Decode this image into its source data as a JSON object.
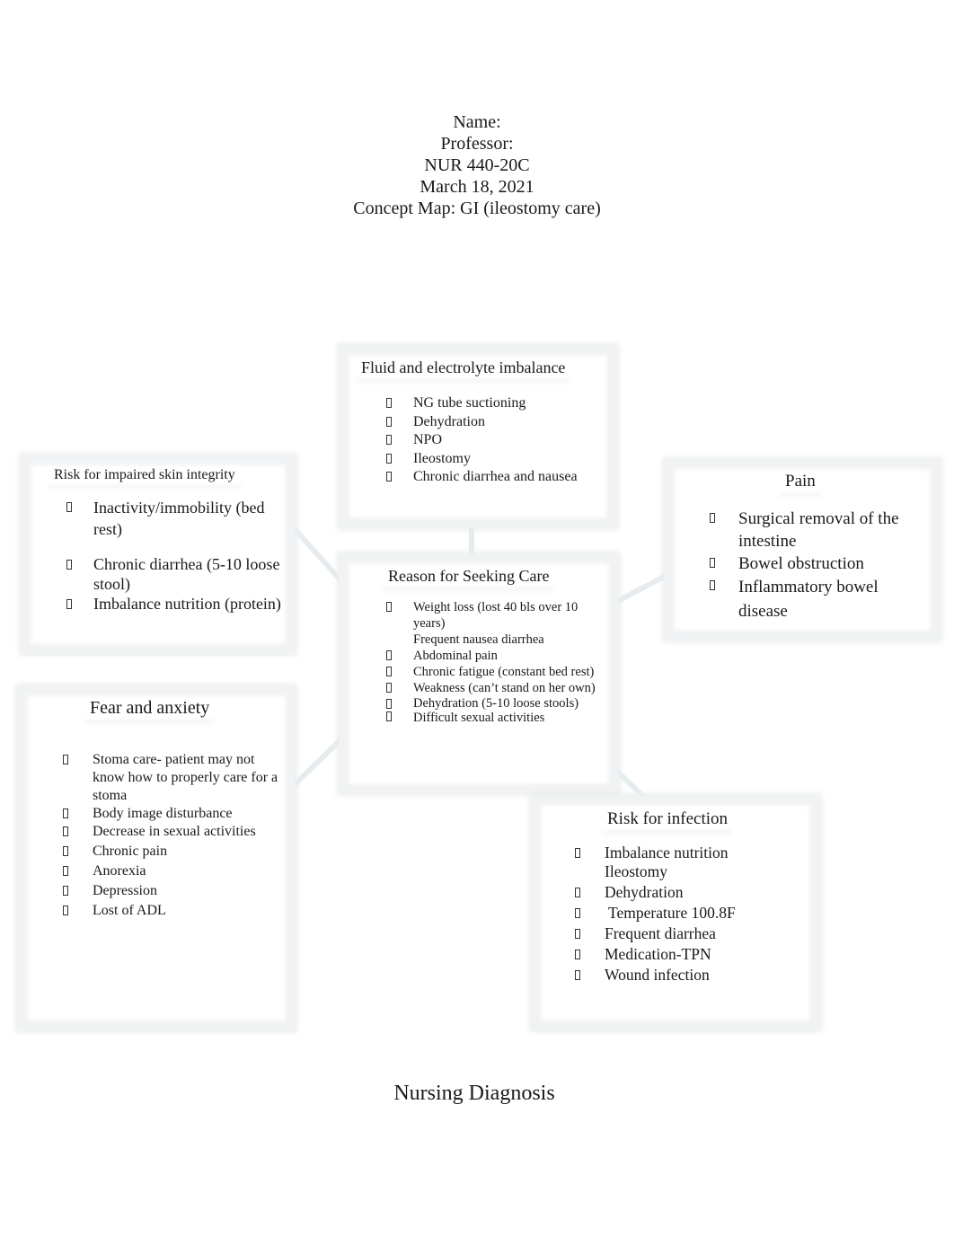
{
  "header": {
    "name_label": "Name:",
    "professor_label": "Professor:",
    "course": "NUR 440-20C",
    "date": "March 18, 2021",
    "title": "Concept Map: GI (ileostomy care)"
  },
  "boxes": {
    "fluid": {
      "title": "Fluid and electrolyte imbalance",
      "items": [
        "NG tube suctioning",
        "Dehydration",
        "NPO",
        "Ileostomy",
        "Chronic diarrhea and nausea"
      ]
    },
    "skin": {
      "title": "Risk for impaired skin integrity",
      "items": [
        "Inactivity/immobility (bed rest)",
        "Chronic diarrhea (5-10 loose stool)",
        "Imbalance nutrition (protein)"
      ]
    },
    "pain": {
      "title": "Pain",
      "items": [
        "Surgical removal of the intestine",
        "Bowel obstruction",
        "Inflammatory bowel disease"
      ]
    },
    "reason": {
      "title": "Reason for Seeking Care",
      "items": [
        "Weight loss (lost 40 bls over 10 years)",
        "Frequent nausea diarrhea",
        "Abdominal pain",
        "Chronic fatigue (constant bed rest)",
        "Weakness (can’t stand on her own)",
        "Dehydration (5-10 loose stools)",
        "Difficult sexual activities"
      ]
    },
    "fear": {
      "title": "Fear and anxiety",
      "items": [
        "Stoma care- patient may not know how to properly care for a stoma",
        "Body image disturbance",
        "Decrease in sexual activities",
        "Chronic pain",
        "Anorexia",
        "Depression",
        "Lost of ADL"
      ]
    },
    "infection": {
      "title": "Risk for infection",
      "items": [
        "Imbalance nutrition Ileostomy",
        "Dehydration",
        " Temperature 100.8F",
        "Frequent diarrhea",
        "Medication-TPN",
        "Wound infection"
      ]
    }
  },
  "footer": {
    "caption": "Nursing Diagnosis"
  },
  "colors": {
    "box_border": "#f1f2f3",
    "connector": "#dfe6ea",
    "text": "#1a1a1a"
  }
}
